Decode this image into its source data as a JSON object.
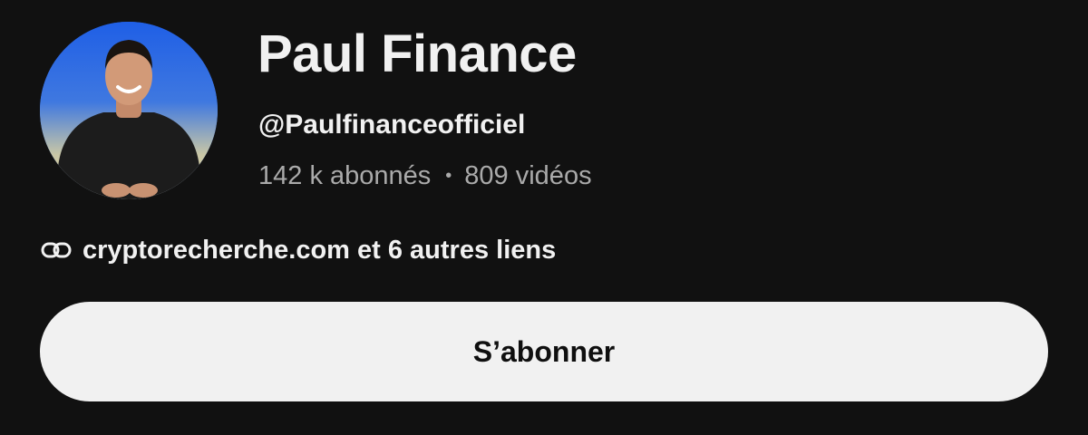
{
  "channel": {
    "name": "Paul Finance",
    "handle": "@Paulfinanceofficiel",
    "subscribers": "142 k abonnés",
    "separator": "•",
    "videos": "809 vidéos"
  },
  "links": {
    "icon": "link-icon",
    "text": "cryptorecherche.com et 6 autres liens"
  },
  "subscribe_button": {
    "label": "S’abonner"
  },
  "colors": {
    "background": "#111111",
    "primary_text": "#f1f1f1",
    "secondary_text": "#aaaaaa",
    "button_background": "#f1f1f1",
    "button_text": "#0f0f0f"
  }
}
